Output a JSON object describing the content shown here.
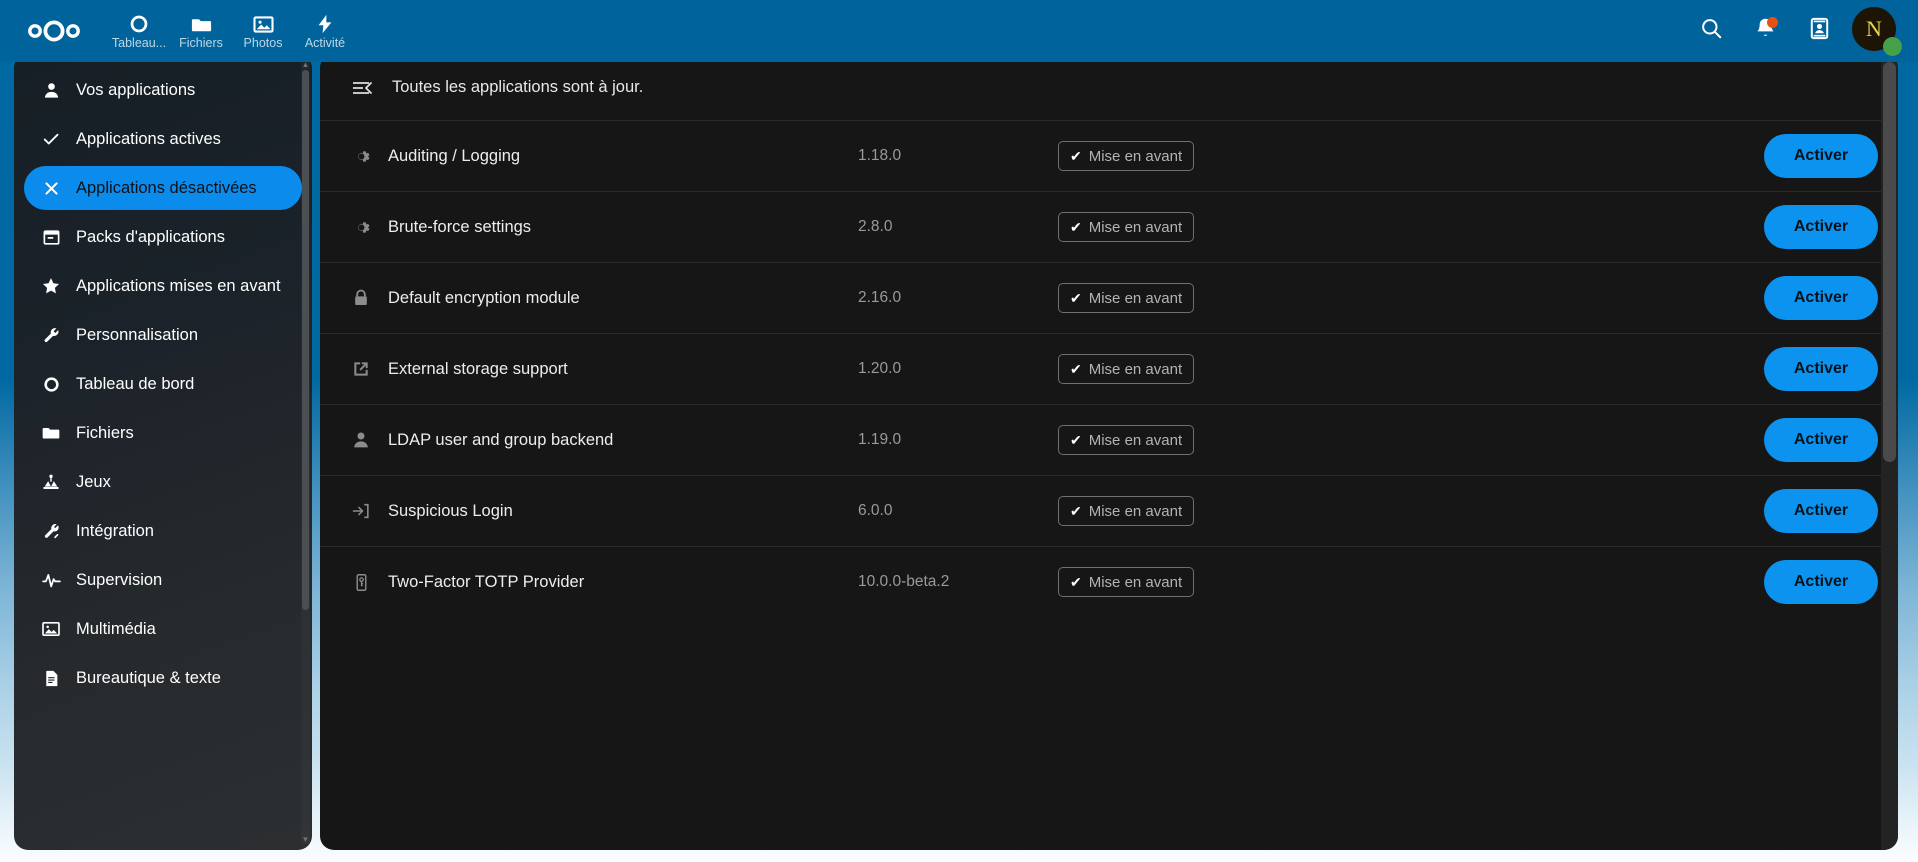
{
  "header": {
    "logo_name": "nextcloud-logo",
    "nav_apps": [
      {
        "label": "Tableau...",
        "icon": "dashboard-icon"
      },
      {
        "label": "Fichiers",
        "icon": "folder-icon"
      },
      {
        "label": "Photos",
        "icon": "photos-icon"
      },
      {
        "label": "Activité",
        "icon": "activity-icon"
      }
    ],
    "actions": [
      {
        "name": "search-icon",
        "label": "Rechercher"
      },
      {
        "name": "notifications-icon",
        "label": "Notifications"
      },
      {
        "name": "contacts-icon",
        "label": "Contacts"
      }
    ],
    "avatar_initial": "N",
    "status": "online",
    "bar_color": "#00639b",
    "notification_dot_color": "#e8500f",
    "status_dot_color": "#46a049"
  },
  "sidebar": {
    "items": [
      {
        "label": "Vos applications",
        "icon": "user-icon",
        "active": false
      },
      {
        "label": "Applications actives",
        "icon": "check-icon",
        "active": false
      },
      {
        "label": "Applications désactivées",
        "icon": "close-icon",
        "active": true
      },
      {
        "label": "Packs d'applications",
        "icon": "archive-icon",
        "active": false
      },
      {
        "label": "Applications mises en avant",
        "icon": "star-icon",
        "active": false
      },
      {
        "label": "Personnalisation",
        "icon": "wrench-icon",
        "active": false
      },
      {
        "label": "Tableau de bord",
        "icon": "circle-icon",
        "active": false
      },
      {
        "label": "Fichiers",
        "icon": "folder-icon",
        "active": false
      },
      {
        "label": "Jeux",
        "icon": "games-icon",
        "active": false
      },
      {
        "label": "Intégration",
        "icon": "plug-icon",
        "active": false
      },
      {
        "label": "Supervision",
        "icon": "pulse-icon",
        "active": false
      },
      {
        "label": "Multimédia",
        "icon": "image-icon",
        "active": false
      },
      {
        "label": "Bureautique & texte",
        "icon": "document-icon",
        "active": false
      }
    ],
    "active_color": "#0b8ced"
  },
  "main": {
    "collapse_icon": "collapse-sidebar-icon",
    "update_status": "Toutes les applications sont à jour.",
    "featured_label": "Mise en avant",
    "enable_label": "Activer",
    "enable_button_color": "#0b93ef",
    "apps": [
      {
        "name": "Auditing / Logging",
        "version": "1.18.0",
        "icon": "gear-icon",
        "featured": true,
        "enable": "Activer"
      },
      {
        "name": "Brute-force settings",
        "version": "2.8.0",
        "icon": "gear-icon",
        "featured": true,
        "enable": "Activer"
      },
      {
        "name": "Default encryption module",
        "version": "2.16.0",
        "icon": "lock-icon",
        "featured": true,
        "enable": "Activer"
      },
      {
        "name": "External storage support",
        "version": "1.20.0",
        "icon": "external-link-icon",
        "featured": true,
        "enable": "Activer"
      },
      {
        "name": "LDAP user and group backend",
        "version": "1.19.0",
        "icon": "account-icon",
        "featured": true,
        "enable": "Activer"
      },
      {
        "name": "Suspicious Login",
        "version": "6.0.0",
        "icon": "login-icon",
        "featured": true,
        "enable": "Activer"
      },
      {
        "name": "Two-Factor TOTP Provider",
        "version": "10.0.0-beta.2",
        "icon": "phone-key-icon",
        "featured": true,
        "enable": "Activer"
      }
    ]
  }
}
